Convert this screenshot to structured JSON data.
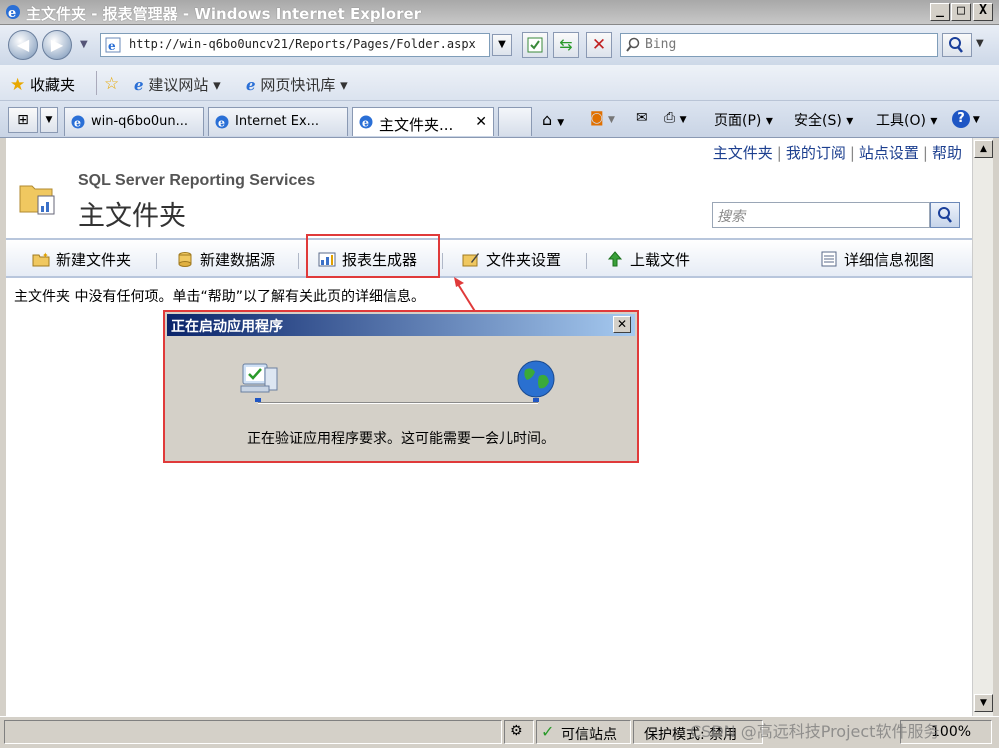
{
  "window": {
    "title": "主文件夹 - 报表管理器 - Windows Internet Explorer",
    "controls": [
      "_",
      "□",
      "X"
    ]
  },
  "addressbar": {
    "url": "http://win-q6bo0uncv21/Reports/Pages/Folder.aspx",
    "search_placeholder": "Bing"
  },
  "favorites": {
    "label": "收藏夹",
    "items": [
      "建议网站 ▾",
      "网页快讯库 ▾"
    ]
  },
  "tabs": [
    {
      "label": "win-q6bo0un..."
    },
    {
      "label": "Internet Ex..."
    },
    {
      "label": "主文件夹..."
    }
  ],
  "commandbar": {
    "page": "页面(P) ▾",
    "safety": "安全(S) ▾",
    "tools": "工具(O) ▾"
  },
  "page": {
    "top_links": [
      "主文件夹",
      "我的订阅",
      "站点设置",
      "帮助"
    ],
    "product": "SQL Server Reporting Services",
    "heading": "主文件夹",
    "search_placeholder": "搜索",
    "toolbar": {
      "new_folder": "新建文件夹",
      "new_datasource": "新建数据源",
      "report_builder": "报表生成器",
      "folder_settings": "文件夹设置",
      "upload": "上载文件",
      "details_view": "详细信息视图"
    },
    "empty_message": "主文件夹 中没有任何项。单击“帮助”以了解有关此页的详细信息。"
  },
  "dialog": {
    "title": "正在启动应用程序",
    "message": "正在验证应用程序要求。这可能需要一会儿时间。"
  },
  "statusbar": {
    "zone": "可信站点",
    "protected_mode": "保护模式: 禁用",
    "zoom": "100%"
  },
  "watermark": "CSDN @高远科技Project软件服务",
  "colors": {
    "highlight": "#e03a3a",
    "link": "#1c3f8f",
    "dialog_title_start": "#0a246a",
    "dialog_title_end": "#a6caf0"
  }
}
